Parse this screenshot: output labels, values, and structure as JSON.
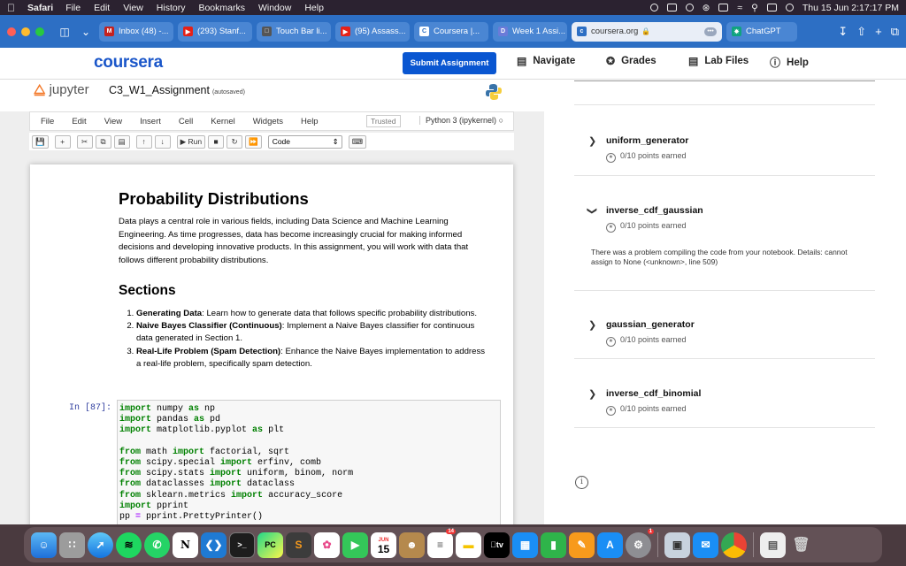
{
  "menubar": {
    "app": "Safari",
    "items": [
      "File",
      "Edit",
      "View",
      "History",
      "Bookmarks",
      "Window",
      "Help"
    ],
    "datetime": "Thu 15 Jun  2:17:17 PM"
  },
  "tabs": [
    {
      "label": "Inbox (48) -...",
      "color": "#c5221f"
    },
    {
      "label": "(293) Stanf...",
      "color": "#e62117"
    },
    {
      "label": "Touch Bar li...",
      "color": "#555555"
    },
    {
      "label": "(95) Assass...",
      "color": "#e62117"
    },
    {
      "label": "Coursera |...",
      "color": "#2d6fc4"
    },
    {
      "label": "Week 1 Assi...",
      "color": "#6a7bd8"
    }
  ],
  "active_tab": {
    "label": "coursera.org"
  },
  "extra_tab": {
    "label": "ChatGPT"
  },
  "header": {
    "logo": "coursera",
    "submit": "Submit Assignment",
    "nav": [
      {
        "label": "Navigate",
        "icon": "navigate-icon"
      },
      {
        "label": "Grades",
        "icon": "grades-icon"
      },
      {
        "label": "Lab Files",
        "icon": "lab-files-icon"
      },
      {
        "label": "Help",
        "icon": "help-icon"
      }
    ]
  },
  "jupyter": {
    "logo": "jupyter",
    "title": "C3_W1_Assignment",
    "saved": "(autosaved)",
    "menu": [
      "File",
      "Edit",
      "View",
      "Insert",
      "Cell",
      "Kernel",
      "Widgets",
      "Help"
    ],
    "trusted": "Trusted",
    "kernel": "Python 3 (ipykernel)",
    "cell_type": "Code",
    "run_label": "Run"
  },
  "notebook": {
    "title": "Probability Distributions",
    "intro": "Data plays a central role in various fields, including Data Science and Machine Learning Engineering. As time progresses, data has become increasingly crucial for making informed decisions and developing innovative products. In this assignment, you will work with data that follows different probability distributions.",
    "sections_title": "Sections",
    "sections": [
      {
        "bold": "Generating Data",
        "text": ": Learn how to generate data that follows specific probability distributions."
      },
      {
        "bold": "Naive Bayes Classifier (Continuous)",
        "text": ": Implement a Naive Bayes classifier for continuous data generated in Section 1."
      },
      {
        "bold": "Real-Life Problem (Spam Detection)",
        "text": ": Enhance the Naive Bayes implementation to address a real-life problem, specifically spam detection."
      }
    ],
    "prompt": "In [87]:"
  },
  "grader": {
    "items": [
      {
        "name": "uniform_generator",
        "points": "0/10 points earned",
        "expanded": false
      },
      {
        "name": "inverse_cdf_gaussian",
        "points": "0/10 points earned",
        "expanded": true
      },
      {
        "name": "gaussian_generator",
        "points": "0/10 points earned",
        "expanded": false
      },
      {
        "name": "inverse_cdf_binomial",
        "points": "0/10 points earned",
        "expanded": false
      }
    ],
    "error": "There was a problem compiling the code from your notebook. Details: cannot assign to None (<unknown>, line 509)"
  },
  "dock": {
    "calendar_month": "JUN",
    "calendar_day": "15",
    "reminders_badge": "14",
    "settings_badge": "1"
  }
}
